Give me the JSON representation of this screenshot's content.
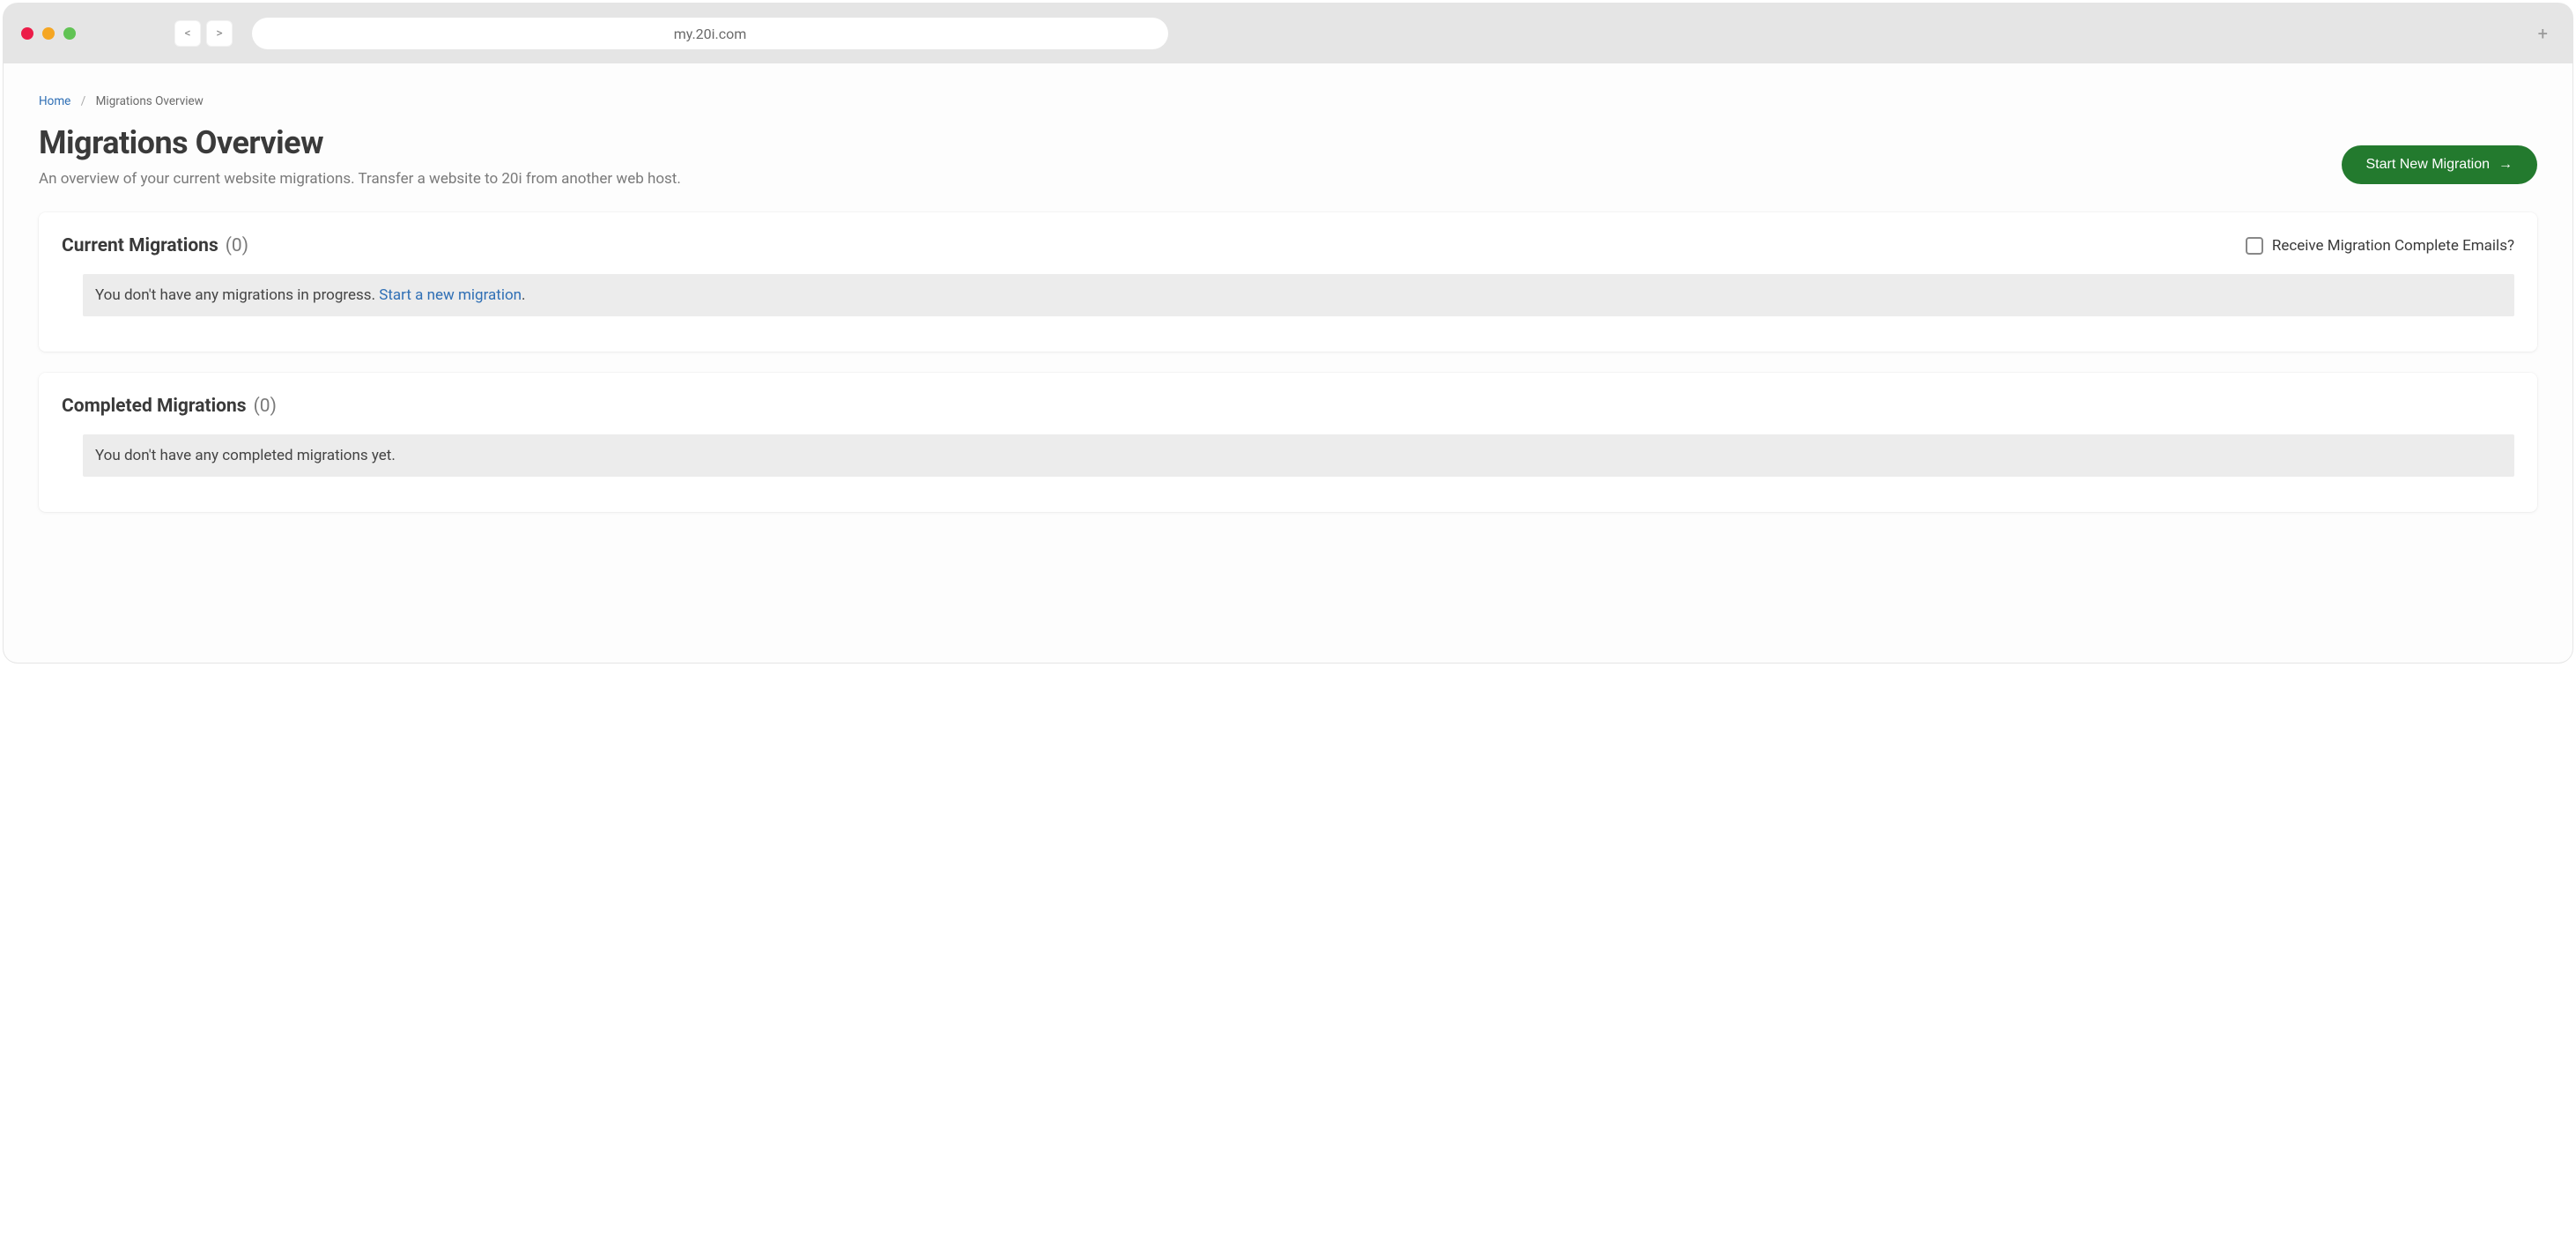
{
  "browser": {
    "nav_back": "<",
    "nav_forward": ">",
    "url": "my.20i.com",
    "new_tab": "+"
  },
  "breadcrumbs": {
    "home": "Home",
    "sep": "/",
    "current": "Migrations Overview"
  },
  "header": {
    "title": "Migrations Overview",
    "subtitle": "An overview of your current website migrations. Transfer a website to 20i from another web host.",
    "button": "Start New Migration",
    "button_arrow": "→"
  },
  "current": {
    "title": "Current Migrations",
    "count": "(0)",
    "checkbox_label": "Receive Migration Complete Emails?",
    "banner_text": "You don't have any migrations in progress. ",
    "banner_link": "Start a new migration",
    "banner_suffix": "."
  },
  "completed": {
    "title": "Completed Migrations",
    "count": "(0)",
    "banner_text": "You don't have any completed migrations yet."
  }
}
